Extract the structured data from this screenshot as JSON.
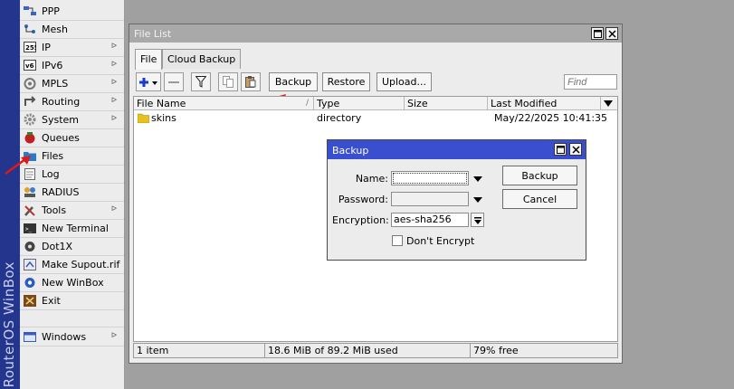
{
  "app": {
    "brand": "RouterOS WinBox"
  },
  "sidebar": {
    "items": [
      {
        "label": "PPP",
        "icon": "ppp-icon",
        "has_submenu": false
      },
      {
        "label": "Mesh",
        "icon": "mesh-icon",
        "has_submenu": false
      },
      {
        "label": "IP",
        "icon": "ip-icon",
        "has_submenu": true
      },
      {
        "label": "IPv6",
        "icon": "ipv6-icon",
        "has_submenu": true
      },
      {
        "label": "MPLS",
        "icon": "mpls-icon",
        "has_submenu": true
      },
      {
        "label": "Routing",
        "icon": "routing-icon",
        "has_submenu": true
      },
      {
        "label": "System",
        "icon": "gear-icon",
        "has_submenu": true
      },
      {
        "label": "Queues",
        "icon": "queues-icon",
        "has_submenu": false
      },
      {
        "label": "Files",
        "icon": "folder-icon",
        "has_submenu": false
      },
      {
        "label": "Log",
        "icon": "log-icon",
        "has_submenu": false
      },
      {
        "label": "RADIUS",
        "icon": "radius-icon",
        "has_submenu": false
      },
      {
        "label": "Tools",
        "icon": "tools-icon",
        "has_submenu": true
      },
      {
        "label": "New Terminal",
        "icon": "terminal-icon",
        "has_submenu": false
      },
      {
        "label": "Dot1X",
        "icon": "dot1x-icon",
        "has_submenu": false
      },
      {
        "label": "Make Supout.rif",
        "icon": "supout-icon",
        "has_submenu": false
      },
      {
        "label": "New WinBox",
        "icon": "winbox-icon",
        "has_submenu": false
      },
      {
        "label": "Exit",
        "icon": "exit-icon",
        "has_submenu": false
      },
      {
        "label": "Windows",
        "icon": "windows-icon",
        "has_submenu": true
      }
    ]
  },
  "file_window": {
    "title": "File List",
    "tabs": [
      "File",
      "Cloud Backup"
    ],
    "active_tab": "File",
    "toolbar": {
      "backup_label": "Backup",
      "restore_label": "Restore",
      "upload_label": "Upload...",
      "find_placeholder": "Find"
    },
    "columns": [
      "File Name",
      "Type",
      "Size",
      "Last Modified"
    ],
    "rows": [
      {
        "name": "skins",
        "type": "directory",
        "size": "",
        "modified": "May/22/2025 10:41:35"
      }
    ],
    "status": {
      "items": "1 item",
      "usage": "18.6 MiB of 89.2 MiB used",
      "free": "79% free"
    }
  },
  "backup_dialog": {
    "title": "Backup",
    "name_label": "Name:",
    "name_value": "",
    "password_label": "Password:",
    "password_value": "",
    "encryption_label": "Encryption:",
    "encryption_value": "aes-sha256",
    "dont_encrypt_label": "Don't Encrypt",
    "dont_encrypt_checked": false,
    "backup_button": "Backup",
    "cancel_button": "Cancel"
  },
  "colors": {
    "brand_strip": "#24358e",
    "dialog_title": "#3a4fd0",
    "annotation_arrow": "#e01818",
    "folder": "#e8c020"
  }
}
